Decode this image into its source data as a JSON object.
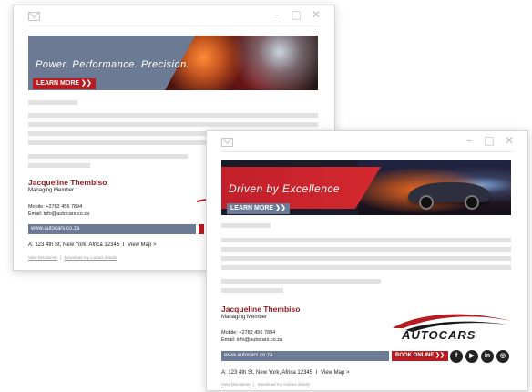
{
  "window_controls": {
    "minimize": "–",
    "maximize": "□",
    "close": "✕"
  },
  "email_a": {
    "banner": {
      "headline": "Power. Performance. Precision.",
      "cta": "LEARN MORE ❯❯"
    },
    "signature": {
      "name": "Jacqueline Thembiso",
      "role": "Managing Member",
      "mobile": "Mobile: +2782 456 7894",
      "email": "Email: info@autocars.co.za",
      "website": "www.autocars.co.za",
      "address": "A: 123 4th St, New York, Africa 12345",
      "separator": "I",
      "view_map": "View Map >",
      "disclaimer": "View Disclaimer",
      "link_sep": "|",
      "download": "Download my contact details"
    }
  },
  "email_b": {
    "banner": {
      "headline": "Driven by Excellence",
      "cta": "LEARN MORE ❯❯"
    },
    "signature": {
      "name": "Jacqueline Thembiso",
      "role": "Managing Member",
      "mobile": "Mobile: +2782 456 7894",
      "email": "Email: info@autocars.co.za",
      "website": "www.autocars.co.za",
      "book_online": "BOOK ONLINE ❯❯",
      "address": "A: 123 4th St, New York, Africa 12345",
      "separator": "I",
      "view_map": "View Map >",
      "disclaimer": "View Disclaimer",
      "link_sep": "|",
      "download": "Download my contact details",
      "logo_text": "AUTOCARS",
      "social": {
        "facebook": "f",
        "youtube": "▶",
        "linkedin": "in",
        "instagram": "◎"
      }
    }
  },
  "colors": {
    "brand_red": "#b71c22",
    "slate": "#6b7a95",
    "name_red": "#8e1b20"
  }
}
